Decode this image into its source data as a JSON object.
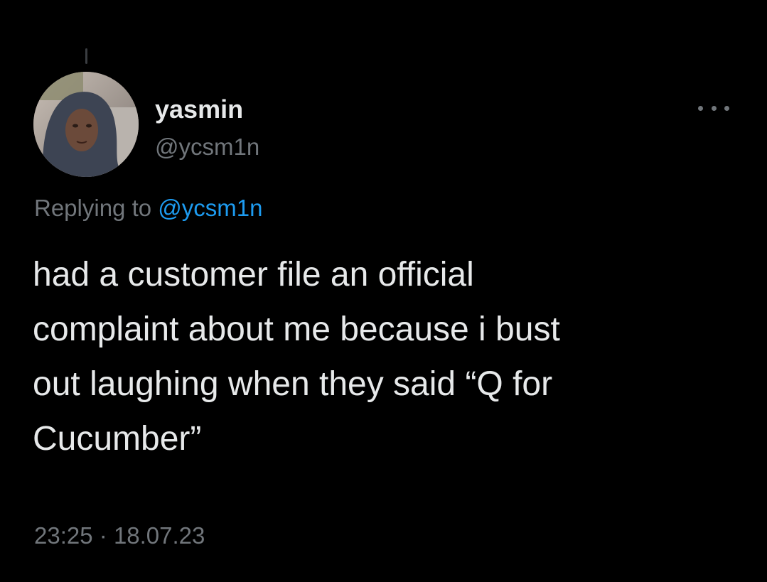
{
  "tweet": {
    "author": {
      "display_name": "yasmin",
      "handle": "@ycsm1n",
      "avatar_icon": "profile-photo"
    },
    "more_icon": "more-options-icon",
    "replying_to": {
      "prefix": "Replying to",
      "handle": "@ycsm1n"
    },
    "text_lines": [
      "had a customer file an official",
      "complaint about me because i bust",
      "out laughing when they said “Q for",
      "Cucumber”"
    ],
    "time": "23:25",
    "separator": "·",
    "date": "18.07.23"
  },
  "colors": {
    "background": "#000000",
    "primary_text": "#e7e9ea",
    "secondary_text": "#71767b",
    "link": "#1d9bf0"
  }
}
